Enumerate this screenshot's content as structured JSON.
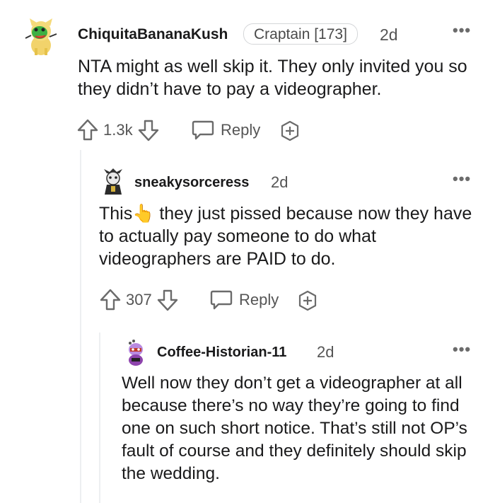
{
  "comments": [
    {
      "username": "ChiquitaBananaKush",
      "flair": "Craptain [173]",
      "time": "2d",
      "text": "NTA might as well skip it. They only invited you so they didn’t have to pay a videographer.",
      "votes": "1.3k",
      "reply_label": "Reply"
    },
    {
      "username": "sneakysorceress",
      "time": "2d",
      "text_before_emoji": "This",
      "emoji": "👆",
      "text_after_emoji": " they just pissed because now they have to actually pay someone to do what videographers are PAID to do.",
      "votes": "307",
      "reply_label": "Reply"
    },
    {
      "username": "Coffee-Historian-11",
      "time": "2d",
      "text": "Well now they don’t get a videographer at all because there’s no way they’re going to find one on such short notice. That’s still not OP’s fault of course and they definitely should skip the wedding."
    }
  ],
  "icons": {
    "more": "more-options-icon",
    "upvote": "upvote-arrow-icon",
    "downvote": "downvote-arrow-icon",
    "reply": "reply-bubble-icon",
    "award": "award-plus-icon"
  },
  "colors": {
    "text": "#1a1a1b",
    "meta": "#555555",
    "thread_line": "#edeff1",
    "emoji": "#f5b800"
  }
}
